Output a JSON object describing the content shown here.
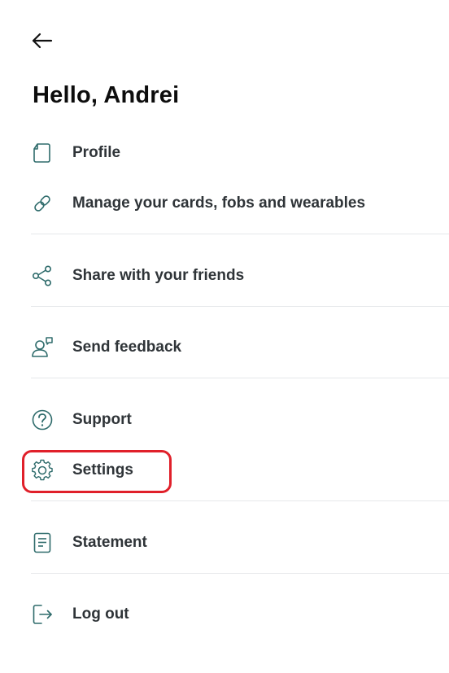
{
  "header": {
    "back_icon": "arrow-left-icon",
    "greeting": "Hello, Andrei"
  },
  "menu": {
    "items": [
      {
        "label": "Profile",
        "icon": "document-icon"
      },
      {
        "label": "Manage your cards, fobs and wearables",
        "icon": "link-icon"
      },
      {
        "label": "Share with your friends",
        "icon": "share-icon"
      },
      {
        "label": "Send feedback",
        "icon": "feedback-icon"
      },
      {
        "label": "Support",
        "icon": "help-circle-icon"
      },
      {
        "label": "Settings",
        "icon": "gear-icon"
      },
      {
        "label": "Statement",
        "icon": "statement-icon"
      },
      {
        "label": "Log out",
        "icon": "logout-icon"
      }
    ]
  },
  "colors": {
    "icon": "#2e6b6b",
    "text": "#2f3438",
    "highlight": "#e0202a"
  }
}
